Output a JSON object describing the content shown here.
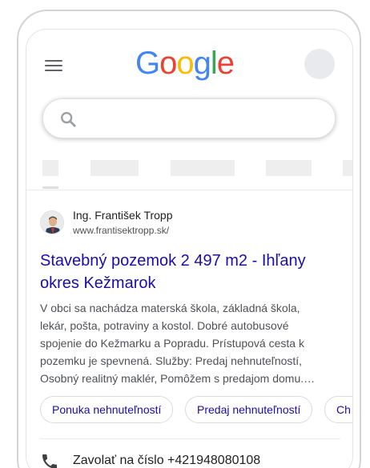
{
  "header": {
    "menu_icon": "hamburger-menu-icon",
    "logo": {
      "letters": [
        "G",
        "o",
        "o",
        "g",
        "l",
        "e"
      ]
    },
    "avatar_icon": "profile-avatar"
  },
  "search": {
    "value": "",
    "icon": "search-icon"
  },
  "result": {
    "site_name": "Ing. František Tropp",
    "url": "www.frantisektropp.sk/",
    "title": "Stavebný pozemok 2 497 m2 - Ihľany okres Kežmarok",
    "snippet": "V obci sa nachádza materská škola, základná škola, lekár, pošta, potraviny a kostol. Dobré autobusové spojenie do Kežmarku a Popradu. Prístupová cesta k pozemku je spevnená. Služby: Predaj nehnuteľností, Osobný realitný maklér, Pomôžem s predajom domu.…",
    "sitelinks": [
      "Ponuka nehnuteľností",
      "Predaj nehnuteľností",
      "Ch"
    ],
    "call": {
      "label": "Zavolať na číslo +421948080108",
      "icon": "phone-icon"
    }
  },
  "colors": {
    "link": "#1a0dab",
    "text": "#202124",
    "snippet": "#4d5156",
    "logo_blue": "#4285f4",
    "logo_red": "#ea4335",
    "logo_yellow": "#fbbc05",
    "logo_green": "#34a853"
  }
}
